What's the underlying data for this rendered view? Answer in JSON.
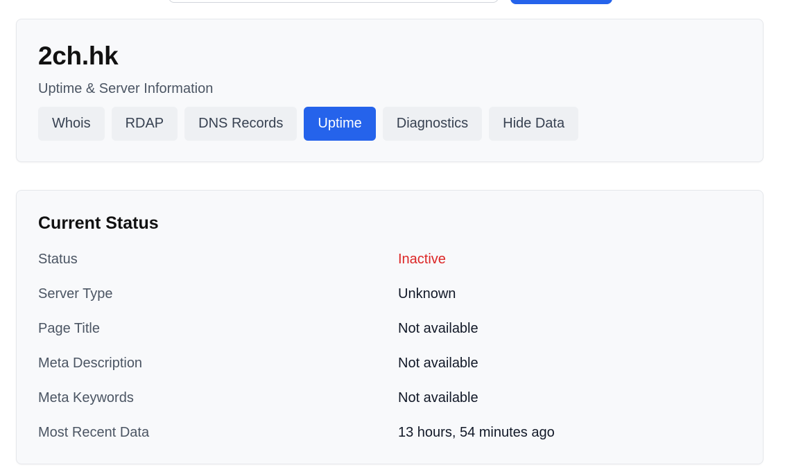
{
  "header": {
    "domain": "2ch.hk",
    "subtitle": "Uptime & Server Information",
    "tabs": [
      {
        "label": "Whois",
        "active": false
      },
      {
        "label": "RDAP",
        "active": false
      },
      {
        "label": "DNS Records",
        "active": false
      },
      {
        "label": "Uptime",
        "active": true
      },
      {
        "label": "Diagnostics",
        "active": false
      },
      {
        "label": "Hide Data",
        "active": false
      }
    ]
  },
  "status": {
    "title": "Current Status",
    "rows": [
      {
        "label": "Status",
        "value": "Inactive"
      },
      {
        "label": "Server Type",
        "value": "Unknown"
      },
      {
        "label": "Page Title",
        "value": "Not available"
      },
      {
        "label": "Meta Description",
        "value": "Not available"
      },
      {
        "label": "Meta Keywords",
        "value": "Not available"
      },
      {
        "label": "Most Recent Data",
        "value": "13 hours, 54 minutes ago"
      }
    ]
  },
  "colors": {
    "accent": "#2563eb",
    "inactive": "#dc2626",
    "card_bg": "#f8f9fb"
  }
}
